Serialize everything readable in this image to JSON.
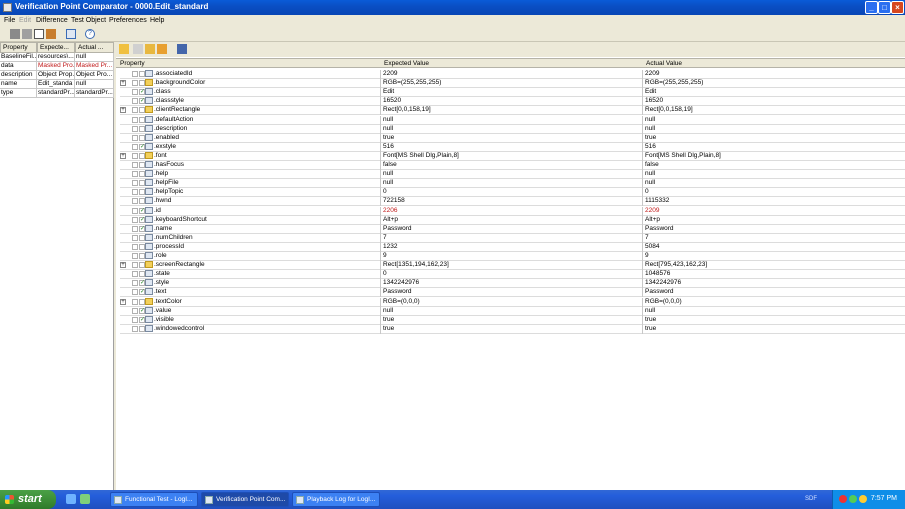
{
  "window": {
    "title": "Verification Point Comparator - 0000.Edit_standard"
  },
  "menu": [
    "File",
    "Edit",
    "Difference",
    "Test Object",
    "Preferences",
    "Help"
  ],
  "left_panel": {
    "headers": [
      "Property",
      "Expecte...",
      "Actual ..."
    ],
    "rows": [
      {
        "property": "BaselineFil...",
        "expected": "resources\\...",
        "actual": "null",
        "masked": false
      },
      {
        "property": "data",
        "expected": "Masked Pro...",
        "actual": "Masked Pr...",
        "masked": true
      },
      {
        "property": "description",
        "expected": "Object Prop...",
        "actual": "Object Pro...",
        "masked": false
      },
      {
        "property": "name",
        "expected": "Edit_standa",
        "actual": "null",
        "masked": false
      },
      {
        "property": "type",
        "expected": "standardPr...",
        "actual": "standardPr...",
        "masked": false
      }
    ]
  },
  "right_panel": {
    "headers": [
      "Property",
      "Expected Value",
      "Actual Value"
    ],
    "rows": [
      {
        "property": ".associatedId",
        "expected": "2209",
        "actual": "2209",
        "expandable": false,
        "checked": false,
        "diff": false
      },
      {
        "property": ".backgroundColor",
        "expected": "RGB=(255,255,255)",
        "actual": "RGB=(255,255,255)",
        "expandable": true,
        "checked": false,
        "diff": false
      },
      {
        "property": ".class",
        "expected": "Edit",
        "actual": "Edit",
        "expandable": false,
        "checked": true,
        "diff": false
      },
      {
        "property": ".classstyle",
        "expected": "16520",
        "actual": "16520",
        "expandable": false,
        "checked": true,
        "diff": false
      },
      {
        "property": ".clientRectangle",
        "expected": "Rect[0,0,158,19]",
        "actual": "Rect[0,0,158,19]",
        "expandable": true,
        "checked": false,
        "diff": false
      },
      {
        "property": ".defaultAction",
        "expected": "null",
        "actual": "null",
        "expandable": false,
        "checked": false,
        "diff": false
      },
      {
        "property": ".description",
        "expected": "null",
        "actual": "null",
        "expandable": false,
        "checked": false,
        "diff": false
      },
      {
        "property": ".enabled",
        "expected": "true",
        "actual": "true",
        "expandable": false,
        "checked": false,
        "diff": false
      },
      {
        "property": ".exstyle",
        "expected": "516",
        "actual": "516",
        "expandable": false,
        "checked": true,
        "diff": false
      },
      {
        "property": ".font",
        "expected": "Font[MS Shell Dlg,Plain,8]",
        "actual": "Font[MS Shell Dlg,Plain,8]",
        "expandable": true,
        "checked": false,
        "diff": false
      },
      {
        "property": ".hasFocus",
        "expected": "false",
        "actual": "false",
        "expandable": false,
        "checked": false,
        "diff": false
      },
      {
        "property": ".help",
        "expected": "null",
        "actual": "null",
        "expandable": false,
        "checked": false,
        "diff": false
      },
      {
        "property": ".helpFile",
        "expected": "null",
        "actual": "null",
        "expandable": false,
        "checked": false,
        "diff": false
      },
      {
        "property": ".helpTopic",
        "expected": "0",
        "actual": "0",
        "expandable": false,
        "checked": false,
        "diff": false
      },
      {
        "property": ".hwnd",
        "expected": "722158",
        "actual": "1115332",
        "expandable": false,
        "checked": false,
        "diff": false
      },
      {
        "property": ".id",
        "expected": "2206",
        "actual": "2209",
        "expandable": false,
        "checked": true,
        "diff": true
      },
      {
        "property": ".keyboardShortcut",
        "expected": "Alt+p",
        "actual": "Alt+p",
        "expandable": false,
        "checked": true,
        "diff": false
      },
      {
        "property": ".name",
        "expected": "Password",
        "actual": "Password",
        "expandable": false,
        "checked": true,
        "diff": false
      },
      {
        "property": ".numChildren",
        "expected": "7",
        "actual": "7",
        "expandable": false,
        "checked": false,
        "diff": false
      },
      {
        "property": ".processId",
        "expected": "1232",
        "actual": "5084",
        "expandable": false,
        "checked": false,
        "diff": false
      },
      {
        "property": ".role",
        "expected": "9",
        "actual": "9",
        "expandable": false,
        "checked": false,
        "diff": false
      },
      {
        "property": ".screenRectangle",
        "expected": "Rect[1351,194,162,23]",
        "actual": "Rect[795,423,162,23]",
        "expandable": true,
        "checked": false,
        "diff": false
      },
      {
        "property": ".state",
        "expected": "0",
        "actual": "1048576",
        "expandable": false,
        "checked": false,
        "diff": false
      },
      {
        "property": ".style",
        "expected": "1342242976",
        "actual": "1342242976",
        "expandable": false,
        "checked": true,
        "diff": false
      },
      {
        "property": ".text",
        "expected": "Password",
        "actual": "Password",
        "expandable": false,
        "checked": true,
        "diff": false
      },
      {
        "property": ".textColor",
        "expected": "RGB=(0,0,0)",
        "actual": "RGB=(0,0,0)",
        "expandable": true,
        "checked": false,
        "diff": false
      },
      {
        "property": ".value",
        "expected": "null",
        "actual": "null",
        "expandable": false,
        "checked": true,
        "diff": false
      },
      {
        "property": ".visible",
        "expected": "true",
        "actual": "true",
        "expandable": false,
        "checked": true,
        "diff": false
      },
      {
        "property": ".windowedcontrol",
        "expected": "true",
        "actual": "true",
        "expandable": false,
        "checked": false,
        "diff": false
      }
    ]
  },
  "taskbar": {
    "start_label": "start",
    "tasks": [
      {
        "label": "Functional Test - LogI...",
        "active": false
      },
      {
        "label": "Verification Point Com...",
        "active": true
      },
      {
        "label": "Playback Log for LogI...",
        "active": false
      }
    ],
    "tray_label": "SDF",
    "clock": "7:57 PM"
  },
  "colors": {
    "diff_text": "#c01818",
    "titlebar": "#0a5bd8",
    "taskbar": "#245edb",
    "start": "#3a8b35"
  }
}
